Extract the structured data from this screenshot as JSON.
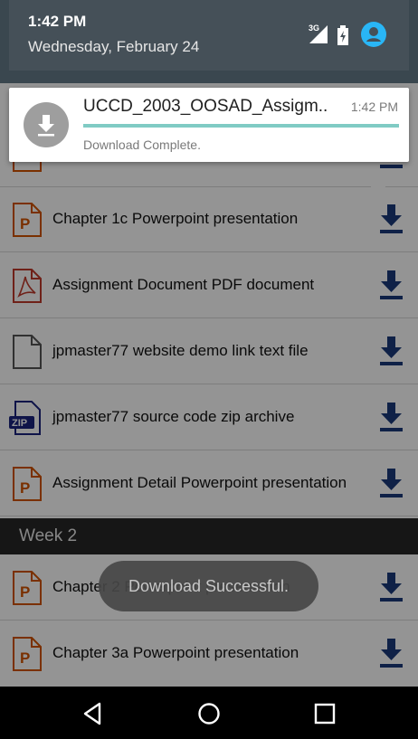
{
  "status_bar": {
    "time": "1:42 PM",
    "date": "Wednesday, February 24",
    "network": "3G"
  },
  "notification": {
    "title": "UCCD_2003_OOSAD_Assigm..",
    "time": "1:42 PM",
    "subtitle": "Download Complete."
  },
  "list": {
    "week1_items": [
      {
        "label": "Chapter 1c Powerpoint presentation",
        "icon": "powerpoint-icon"
      },
      {
        "label": "Assignment Document PDF document",
        "icon": "pdf-icon"
      },
      {
        "label": "jpmaster77 website demo link text file",
        "icon": "text-file-icon"
      },
      {
        "label": "jpmaster77 source code zip archive",
        "icon": "zip-icon"
      },
      {
        "label": "Assignment Detail Powerpoint presentation",
        "icon": "powerpoint-icon"
      }
    ],
    "section_title": "Week 2",
    "week2_items": [
      {
        "label": "Chapter 2 Powerpoint presentation",
        "icon": "powerpoint-icon"
      },
      {
        "label": "Chapter 3a Powerpoint presentation",
        "icon": "powerpoint-icon"
      }
    ]
  },
  "toast": {
    "text": "Download Successful."
  },
  "colors": {
    "accent_blue": "#1a3a7a",
    "ppt_orange": "#d35400",
    "pdf_red": "#c0392b",
    "progress_teal": "#80cbc4"
  }
}
